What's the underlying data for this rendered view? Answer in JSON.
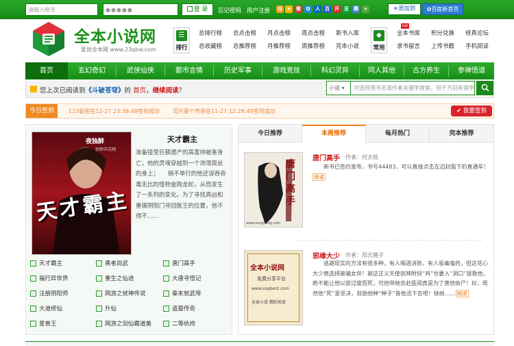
{
  "topbar": {
    "account_placeholder": "请输入帐号",
    "password_placeholder": "●●●●●",
    "login_label": "登 录",
    "forgot_label": "忘记密码",
    "register_label": "用户注册",
    "add_to_label": "添加到",
    "baidu_label": "百度新首页",
    "share_icons": [
      "qzone-icon",
      "star-icon",
      "sina-weibo-icon",
      "qq-icon",
      "renren-icon",
      "baidu-icon",
      "kaixin-icon",
      "douban-icon",
      "tencent-weibo-icon",
      "plus-icon"
    ]
  },
  "header": {
    "logo_text": "全本小说网",
    "logo_sub": "爱尚全本网 www.23qbw.com",
    "rank_label": "排行",
    "rank_links": [
      "总排行榜",
      "总点击榜",
      "月点击榜",
      "周点击榜",
      "新书入库",
      "总收藏榜",
      "总推荐榜",
      "月推荐榜",
      "周推荐榜",
      "完本小说"
    ],
    "common_label": "常用",
    "common_links": [
      "全本书库",
      "积分兑换",
      "修真论坛",
      "求书留言",
      "上传书籍",
      "手机阅读"
    ],
    "hot_badge": "hot"
  },
  "nav": {
    "items": [
      "首页",
      "玄幻奇幻",
      "武侠仙侠",
      "都市言情",
      "历史军事",
      "游戏竞技",
      "科幻灵异",
      "同人其他",
      "古方养生",
      "参禅悟道"
    ],
    "active_index": 0
  },
  "readbar": {
    "prefix": "您上次已阅读到",
    "book": "《斗破苍穹》",
    "mid": "的",
    "chapter": "首页",
    "comma": "，",
    "continue": "继续阅读",
    "end": "？",
    "search_type": "小说",
    "search_placeholder": "可选择用书名或作者关键字搜索，但千万别有错字"
  },
  "checkin": {
    "tab_label": "今日签到",
    "msg1": "123蚯蚓在12-27 23:38:48签到成功",
    "msg2": "司只是个传说在11-27 12:28:49签到成功",
    "button_label": "我要签到"
  },
  "featured": {
    "cover_title": "天才霸主",
    "cover_sub": "夜独醉",
    "cover_brand": "创世中文网",
    "title": "天才霸主",
    "desc": "准备接受巨额遗产的高富帅被害身亡，他的灵魂穿越到一个流氓屌丝的身上；　　祸不单行的他还误吞奇毒无比的怪物金刚龙蛇，从而发生了一系列的变化。为了寻找真凶和重振阴阳门寻回医王的位置，他不得不……"
  },
  "book_list": [
    [
      "天才霸主",
      "勇者尚武",
      "唐门高手"
    ],
    [
      "福行异世界",
      "重生之仙途",
      "大唐寻悟记"
    ],
    [
      "注册阴阳师",
      "网游之就神传说",
      "秦末就武帝"
    ],
    [
      "大道修仙",
      "升仙",
      "盗墓传奇"
    ],
    [
      "星兽王",
      "网游之剑仙霸道美",
      "二等纨绔"
    ]
  ],
  "rec_tabs": [
    "今日推荐",
    "本周推荐",
    "每月热门",
    "完本推荐"
  ],
  "rec_active": 1,
  "recommendations": [
    {
      "title": "唐门高手",
      "author_prefix": "作者：",
      "author": "何太极",
      "desc": "新书已签约发布，书号44483，可以直接点击左边封面下的直通车！",
      "tag": "阅读",
      "cover_text": "唐门高手",
      "cover_site": "www.zongheng.com"
    },
    {
      "title": "邪缘大少",
      "author_prefix": "作者：",
      "author": "阳光猪子",
      "desc": "逃避现实的方法有很多种，有人喝酒消愁，有人吸毒嗑药，但这花心大少竟选择被骗女伴！被这正义天使就神附拐“鸡”也要入“洞口”拯救他，绝不能让他以欲过度而死，可他带她去赴医闹真是为了普他收尸！好，既然他“死”意坚决，就助他种“种子”昔他活下去吧！钵她……",
      "tag": "阅读",
      "cover_title": "全本小说网",
      "cover_line1": "免费分享平台",
      "cover_line2": "www.xsqbent.com",
      "cover_line3": "全本小说 精彩阅读"
    }
  ],
  "colors": {
    "brand_green": "#1a8a1a",
    "nav_active": "#0c6f0c",
    "orange": "#f08a22",
    "red": "#d01818"
  }
}
